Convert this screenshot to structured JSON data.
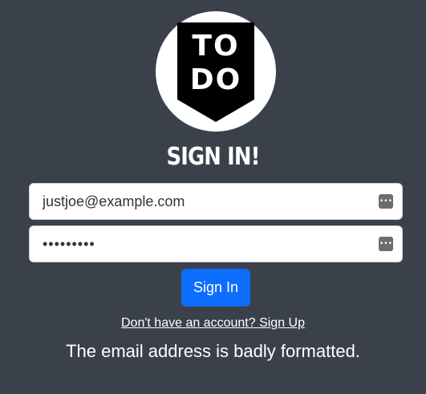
{
  "logo": {
    "line1": "TO",
    "line2": "DO",
    "icon": "todo-logo-shield"
  },
  "heading": "SIGN IN!",
  "email_field": {
    "value": "justjoe@example.com",
    "icon": "password-manager-icon"
  },
  "password_field": {
    "value": "•••••••••",
    "icon": "password-manager-icon"
  },
  "sign_in_button": "Sign In",
  "signup_link": "Don't have an account? Sign Up",
  "error_message": "The email address is badly formatted.",
  "colors": {
    "background": "#3b414b",
    "primary": "#0d6efd",
    "text": "#ffffff"
  }
}
